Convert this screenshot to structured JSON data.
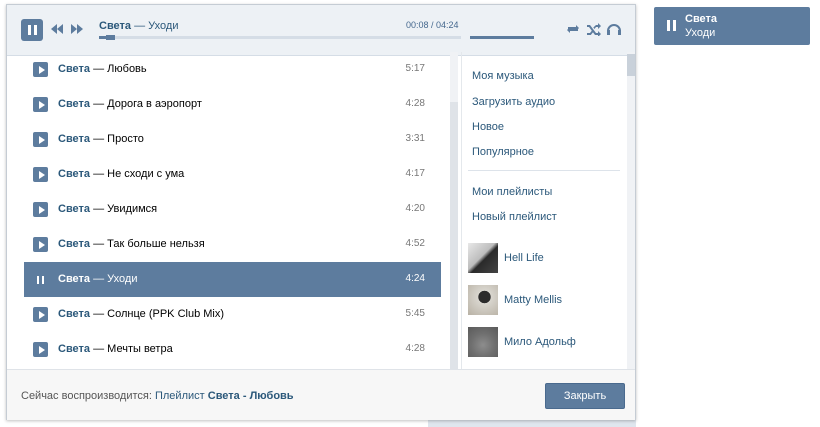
{
  "now_playing": {
    "artist": "Света",
    "separator": "—",
    "song": "Уходи",
    "time_current": "00:08",
    "time_total": "04:24",
    "time_readout": "00:08 / 04:24",
    "progress_fraction": 0.03,
    "volume_fraction": 1.0
  },
  "tracks": [
    {
      "artist": "Света",
      "separator": "—",
      "song": "Любовь",
      "duration": "5:17",
      "active": false
    },
    {
      "artist": "Света",
      "separator": "—",
      "song": "Дорога в аэропорт",
      "duration": "4:28",
      "active": false
    },
    {
      "artist": "Света",
      "separator": "—",
      "song": "Просто",
      "duration": "3:31",
      "active": false
    },
    {
      "artist": "Света",
      "separator": "—",
      "song": "Не сходи с ума",
      "duration": "4:17",
      "active": false
    },
    {
      "artist": "Света",
      "separator": "—",
      "song": "Увидимся",
      "duration": "4:20",
      "active": false
    },
    {
      "artist": "Света",
      "separator": "—",
      "song": "Так больше нельзя",
      "duration": "4:52",
      "active": false
    },
    {
      "artist": "Света",
      "separator": "—",
      "song": "Уходи",
      "duration": "4:24",
      "active": true
    },
    {
      "artist": "Света",
      "separator": "—",
      "song": "Солнце (PPK Club Mix)",
      "duration": "5:45",
      "active": false
    },
    {
      "artist": "Света",
      "separator": "—",
      "song": "Мечты ветра",
      "duration": "4:28",
      "active": false
    }
  ],
  "menu": {
    "items": [
      "Моя музыка",
      "Загрузить аудио",
      "Новое",
      "Популярное"
    ],
    "playlist_items": [
      "Мои плейлисты",
      "Новый плейлист"
    ],
    "friends": [
      "Hell Life",
      "Matty Mellis",
      "Мило Адольф"
    ]
  },
  "footer": {
    "prefix": "Сейчас воспроизводится:",
    "link": "Плейлист",
    "playlist_name": "Света - Любовь",
    "close_label": "Закрыть"
  },
  "mini_player": {
    "artist": "Света",
    "song": "Уходи"
  },
  "icons": {
    "main_button": "pause-icon",
    "prev": "previous-icon",
    "next": "next-icon",
    "repeat": "repeat-icon",
    "shuffle": "shuffle-icon",
    "broadcast": "headphones-icon",
    "track_button": "play-icon",
    "active_track_button": "pause-icon"
  },
  "colors": {
    "accent": "#5d7c9e",
    "link": "#2b587a",
    "header_bg": "#edf1f5"
  }
}
